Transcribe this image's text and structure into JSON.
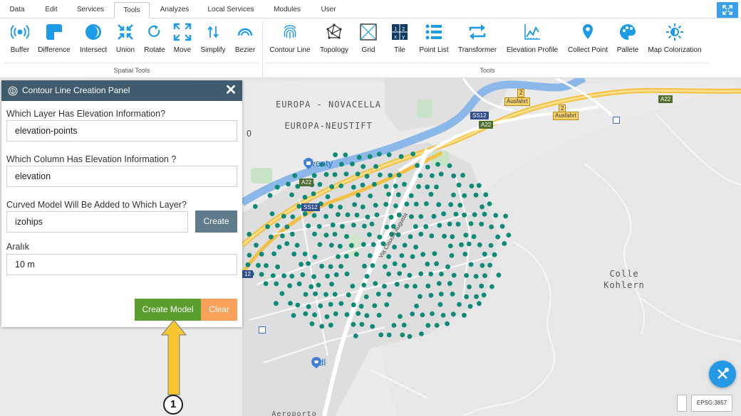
{
  "tabs": [
    "Data",
    "Edit",
    "Services",
    "Tools",
    "Analyzes",
    "Local Services",
    "Modules",
    "User"
  ],
  "active_tab": "Tools",
  "tool_groups": {
    "spatial": {
      "title": "Spatial Tools",
      "tools": [
        "Buffer",
        "Difference",
        "Intersect",
        "Union",
        "Rotate",
        "Move",
        "Simplify",
        "Bezier"
      ]
    },
    "tools": {
      "title": "Tools",
      "tools": [
        "Contour Line",
        "Topology",
        "Grid",
        "Tile",
        "Point List",
        "Transformer",
        "Elevation Profile",
        "Collect Point",
        "Pallete",
        "Map Colorization"
      ]
    }
  },
  "accent_color": "#1e9be6",
  "panel": {
    "title": "Contour Line Creation Panel",
    "q_layer": "Which Layer Has Elevation Information?",
    "v_layer": "elevation-points",
    "q_column": "Which Column Has Elevation Information ?",
    "v_column": "elevation",
    "q_target": "Curved Model Will Be Added to Which Layer?",
    "v_target": "izohips",
    "create_label": "Create",
    "q_interval": "Aralık",
    "v_interval": "10 m",
    "create_model_label": "Create Model",
    "clear_label": "Clear",
    "header_color": "#3f5b6d",
    "create_model_color": "#5a9e2e",
    "clear_color": "#f7a15a"
  },
  "map": {
    "labels": {
      "novacella": "EUROPA - NOVACELLA",
      "neustift": "EUROPA-NEUSTIFT",
      "colle": "Colle",
      "kohlern": "Kohlern",
      "twenty": "Twenty",
      "lidl": "Lidl",
      "aeroporto": "Aeroporto",
      "o_letter": "O",
      "street": "Via Claudia Augusta"
    },
    "shields": [
      "A22",
      "A22",
      "A22",
      "SS12",
      "SS12",
      "12",
      "A22"
    ],
    "exits": [
      "Ausfahrt",
      "Ausfahrt"
    ],
    "exit_numbers": [
      "2",
      "2"
    ],
    "epsg": "EPSG:3857",
    "point_color": "#0d8a78"
  },
  "annotation": {
    "callout_number": "1"
  }
}
